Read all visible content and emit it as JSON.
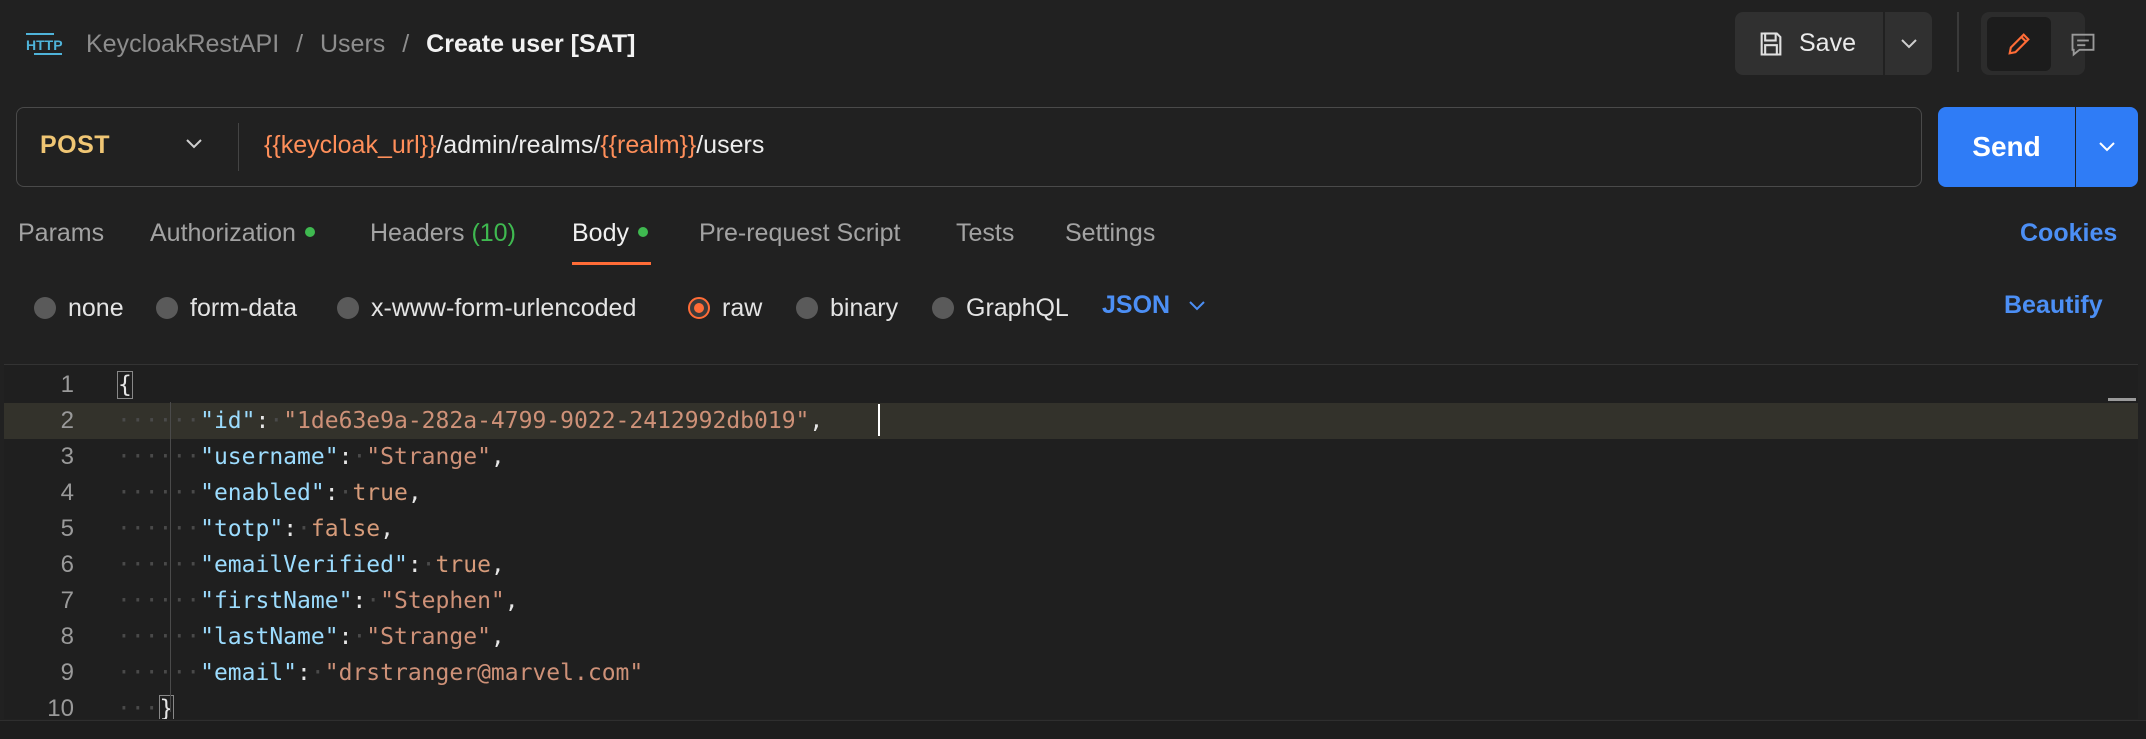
{
  "header": {
    "icon_label": "HTTP",
    "breadcrumb": [
      "KeycloakRestAPI",
      "Users"
    ],
    "separator": "/",
    "title": "Create user [SAT]",
    "save_label": "Save"
  },
  "request": {
    "method": "POST",
    "url_parts": [
      {
        "text": "{{keycloak_url}}",
        "var": true
      },
      {
        "text": "/admin/realms/",
        "var": false
      },
      {
        "text": "{{realm}}",
        "var": true
      },
      {
        "text": "/users",
        "var": false
      }
    ],
    "send_label": "Send"
  },
  "tabs": [
    {
      "label": "Params"
    },
    {
      "label": "Authorization",
      "dot": true
    },
    {
      "label": "Headers",
      "count": "(10)"
    },
    {
      "label": "Body",
      "dot": true,
      "active": true
    },
    {
      "label": "Pre-request Script"
    },
    {
      "label": "Tests"
    },
    {
      "label": "Settings"
    }
  ],
  "cookies_label": "Cookies",
  "body_types": [
    "none",
    "form-data",
    "x-www-form-urlencoded",
    "raw",
    "binary",
    "GraphQL"
  ],
  "body_selected": "raw",
  "format": "JSON",
  "beautify_label": "Beautify",
  "editor": {
    "line_numbers": [
      "1",
      "2",
      "3",
      "4",
      "5",
      "6",
      "7",
      "8",
      "9",
      "10"
    ],
    "lines": [
      {
        "key": "\"id\"",
        "value": "\"1de63e9a-282a-4799-9022-2412992db019\"",
        "type": "str",
        "comma": true
      },
      {
        "key": "\"username\"",
        "value": "\"Strange\"",
        "type": "str",
        "comma": true
      },
      {
        "key": "\"enabled\"",
        "value": "true",
        "type": "bool",
        "comma": true
      },
      {
        "key": "\"totp\"",
        "value": "false",
        "type": "bool",
        "comma": true
      },
      {
        "key": "\"emailVerified\"",
        "value": "true",
        "type": "bool",
        "comma": true
      },
      {
        "key": "\"firstName\"",
        "value": "\"Stephen\"",
        "type": "str",
        "comma": true
      },
      {
        "key": "\"lastName\"",
        "value": "\"Strange\"",
        "type": "str",
        "comma": true
      },
      {
        "key": "\"email\"",
        "value": "\"drstranger@marvel.com\"",
        "type": "str",
        "comma": false
      }
    ],
    "open_brace": "{",
    "close_brace": "}"
  },
  "colors": {
    "accent": "#ff6c37",
    "primary": "#2f7cf6",
    "link": "#4c8ff5",
    "method": "#f0c674",
    "variable": "#ff8f5a",
    "status_dot": "#3fb950"
  }
}
